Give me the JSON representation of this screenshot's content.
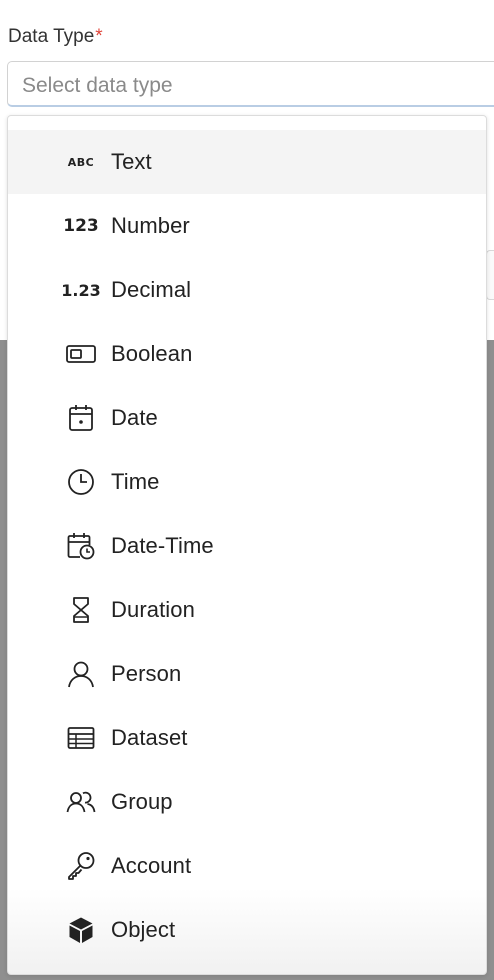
{
  "field": {
    "label": "Data Type",
    "required_mark": "*",
    "placeholder": "Select data type"
  },
  "dropdown": {
    "items": [
      {
        "label": "Text",
        "icon": "text-abc-icon",
        "glyph": "ABC"
      },
      {
        "label": "Number",
        "icon": "number-123-icon",
        "glyph": "123"
      },
      {
        "label": "Decimal",
        "icon": "decimal-icon",
        "glyph": "1.23"
      },
      {
        "label": "Boolean",
        "icon": "toggle-icon"
      },
      {
        "label": "Date",
        "icon": "calendar-icon"
      },
      {
        "label": "Time",
        "icon": "clock-icon"
      },
      {
        "label": "Date-Time",
        "icon": "calendar-clock-icon"
      },
      {
        "label": "Duration",
        "icon": "hourglass-icon"
      },
      {
        "label": "Person",
        "icon": "person-icon"
      },
      {
        "label": "Dataset",
        "icon": "table-icon"
      },
      {
        "label": "Group",
        "icon": "group-icon"
      },
      {
        "label": "Account",
        "icon": "key-icon"
      },
      {
        "label": "Object",
        "icon": "cube-icon"
      }
    ],
    "highlighted_index": 0
  },
  "colors": {
    "required": "#e0473c",
    "overlay": "#8f8f8f",
    "highlight": "#f4f4f4",
    "input_focus_border": "#b9cde4"
  }
}
